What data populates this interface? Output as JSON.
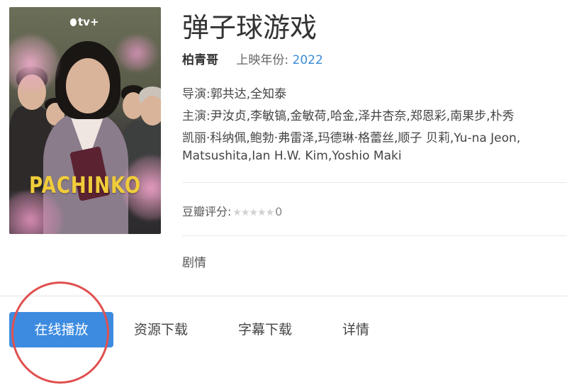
{
  "poster": {
    "brand_text": "tv+",
    "title_text": "PACHINKO",
    "title_color": "#f0cc3a"
  },
  "movie": {
    "title": "弹子球游戏",
    "alt_title": "柏青哥",
    "year_label": "上映年份:",
    "year": "2022",
    "director_label": "导演:",
    "directors": "郭共达,全知泰",
    "cast_label": "主演:",
    "cast_line1": "尹汝贞,李敏镐,金敏荷,哈金,泽井杏奈,郑恩彩,南果步,朴秀",
    "cast_line2": "凯丽·科纳佩,鲍勃·弗雷泽,玛德琳·格蕾丝,顺子 贝莉,Yu-na Jeon,",
    "cast_line3": "Matsushita,Ian H.W. Kim,Yoshio Maki",
    "rating_label": "豆瓣评分:",
    "rating_stars": "★★★★★",
    "rating_score": "0",
    "genre": "剧情"
  },
  "tabs": [
    {
      "label": "在线播放",
      "active": true
    },
    {
      "label": "资源下载",
      "active": false
    },
    {
      "label": "字幕下载",
      "active": false
    },
    {
      "label": "详情",
      "active": false
    }
  ],
  "colors": {
    "accent": "#3d8be0",
    "year_link": "#3b8bd6",
    "annotation": "#e0504f"
  }
}
